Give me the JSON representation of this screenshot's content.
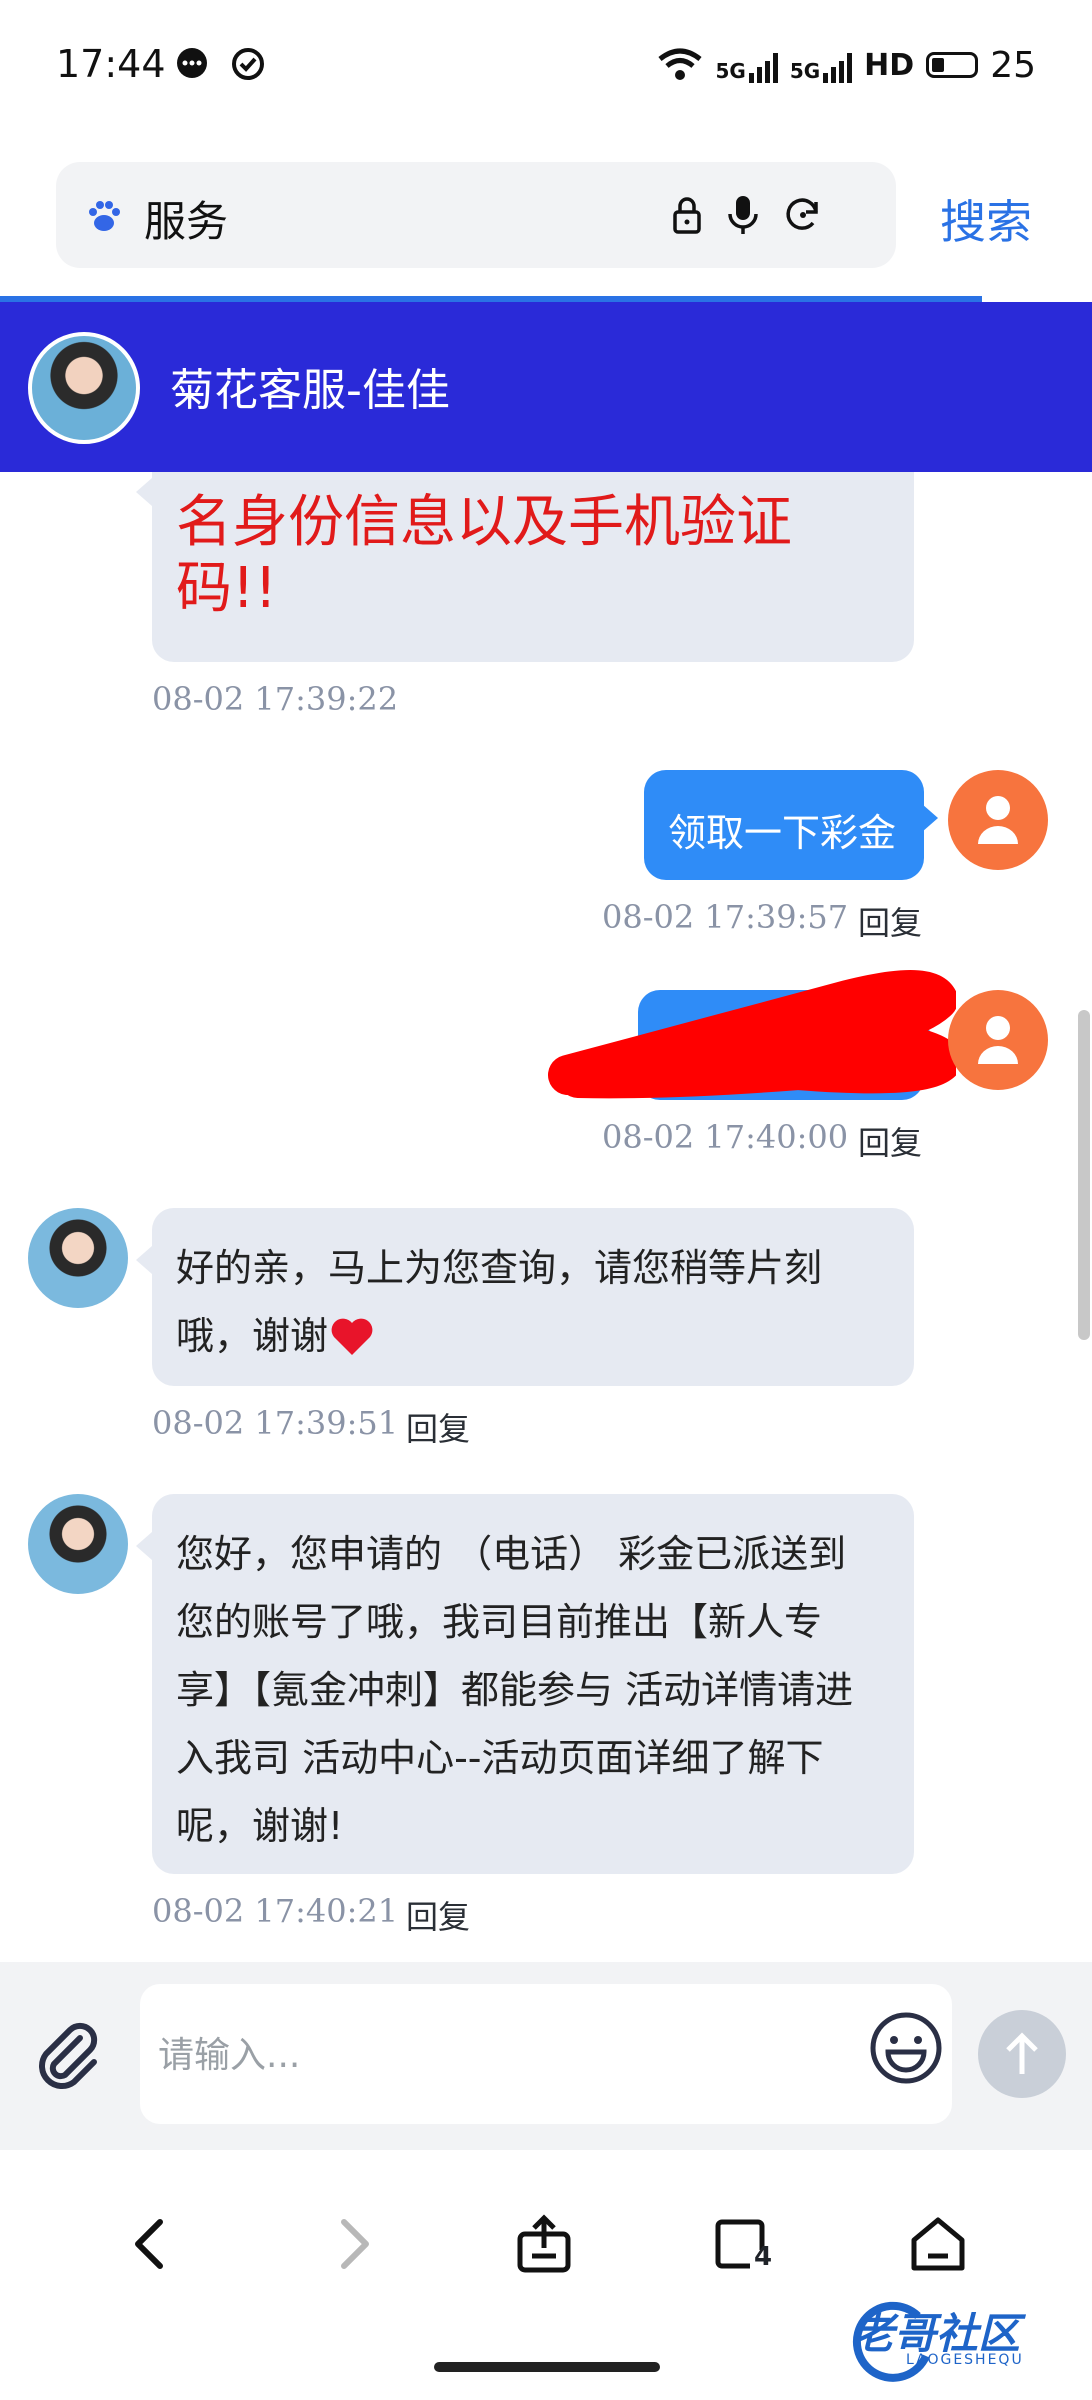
{
  "status_bar": {
    "time": "17:44",
    "network": "5G",
    "hd": "HD",
    "battery": "25"
  },
  "browser": {
    "search_text": "服务",
    "search_button": "搜索"
  },
  "chat": {
    "agent_name": "菊花客服-佳佳",
    "messages": [
      {
        "side": "left",
        "text_line1": "名身份信息以及手机验证",
        "text_line2": "码!!",
        "timestamp": "08-02 17:39:22"
      },
      {
        "side": "right",
        "text": "领取一下彩金",
        "timestamp": "08-02 17:39:57",
        "reply": "回复"
      },
      {
        "side": "right",
        "text": "",
        "redacted": true,
        "timestamp": "08-02 17:40:00",
        "reply": "回复"
      },
      {
        "side": "left",
        "text_line1": "好的亲，马上为您查询，请您稍等片刻",
        "text_line2": "哦，谢谢",
        "timestamp": "08-02 17:39:51",
        "reply": "回复"
      },
      {
        "side": "left",
        "lines": [
          "您好，您申请的 （电话） 彩金已派送到",
          "您的账号了哦，我司目前推出【新人专",
          "享】【氪金冲刺】都能参与  活动详情请进",
          "入我司 活动中心--活动页面详细了解下",
          "呢，谢谢!"
        ],
        "timestamp": "08-02 17:40:21",
        "reply": "回复"
      }
    ]
  },
  "input": {
    "placeholder": "请输入..."
  },
  "watermark": {
    "text": "老哥社区",
    "sub": "LAOGESHEQU"
  },
  "colors": {
    "header_bg": "#2a2ad8",
    "user_bubble": "#2f8cf7",
    "agent_bubble": "#e6eaf2",
    "accent": "#2a72e5",
    "redaction": "#ff0000"
  },
  "icons": [
    "message-icon",
    "check-circle-icon",
    "wifi-icon",
    "signal-icon",
    "battery-icon",
    "paw-icon",
    "lock-icon",
    "mic-icon",
    "refresh-icon",
    "user-icon",
    "heart-icon",
    "paperclip-icon",
    "emoji-icon",
    "send-arrow-icon",
    "back-icon",
    "forward-icon",
    "share-icon",
    "tabs-icon",
    "home-icon"
  ],
  "tabs_count": "4"
}
